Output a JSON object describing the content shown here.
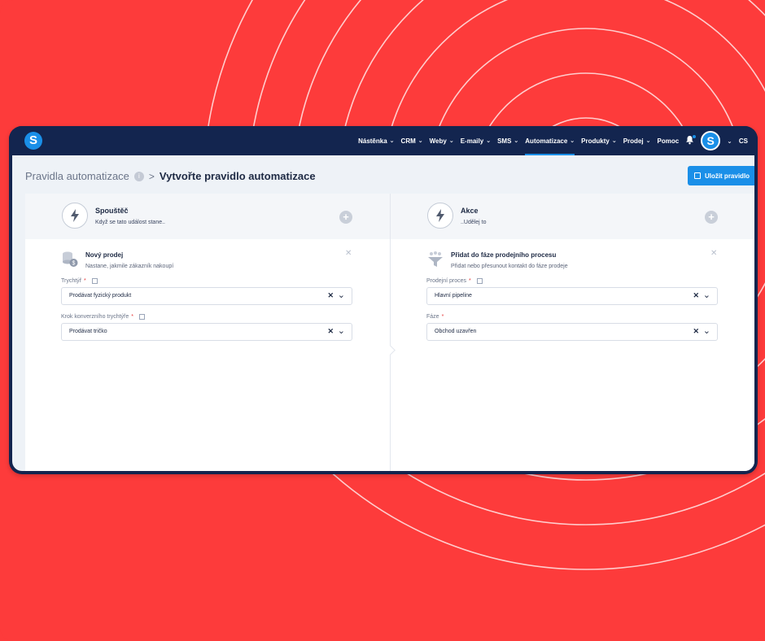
{
  "colors": {
    "background": "#fd3b3b",
    "navbar": "#13254f",
    "accent": "#1a8fe8"
  },
  "logo": {
    "letter": "S"
  },
  "nav": {
    "items": [
      {
        "label": "Nástěnka",
        "chevron": true
      },
      {
        "label": "CRM",
        "chevron": true
      },
      {
        "label": "Weby",
        "chevron": true
      },
      {
        "label": "E-maily",
        "chevron": true
      },
      {
        "label": "SMS",
        "chevron": true
      },
      {
        "label": "Automatizace",
        "chevron": true,
        "active": true
      },
      {
        "label": "Produkty",
        "chevron": true
      },
      {
        "label": "Prodej",
        "chevron": true
      },
      {
        "label": "Pomoc",
        "chevron": false
      }
    ],
    "avatar_letter": "S",
    "language": "CS"
  },
  "breadcrumb": {
    "parent": "Pravidla automatizace",
    "info_badge": "i",
    "separator": ">",
    "current": "Vytvořte pravidlo automatizace"
  },
  "save_button": {
    "label": "Uložit pravidlo"
  },
  "trigger": {
    "title": "Spouštěč",
    "subtitle": "Když se tato událost stane..",
    "card": {
      "title": "Nový prodej",
      "subtitle": "Nastane, jakmile zákazník nakoupí"
    },
    "fields": [
      {
        "label": "Trychtýř",
        "value": "Prodávat fyzický produkt"
      },
      {
        "label": "Krok konverzního trychtýře",
        "value": "Prodávat tričko"
      }
    ]
  },
  "action": {
    "title": "Akce",
    "subtitle": "..Udělej to",
    "card": {
      "title": "Přidat do fáze prodejního procesu",
      "subtitle": "Přidat nebo přesunout kontakt do fáze prodeje"
    },
    "fields": [
      {
        "label": "Prodejní proces",
        "value": "Hlavní pipeline"
      },
      {
        "label": "Fáze",
        "value": "Obchod uzavřen"
      }
    ]
  }
}
